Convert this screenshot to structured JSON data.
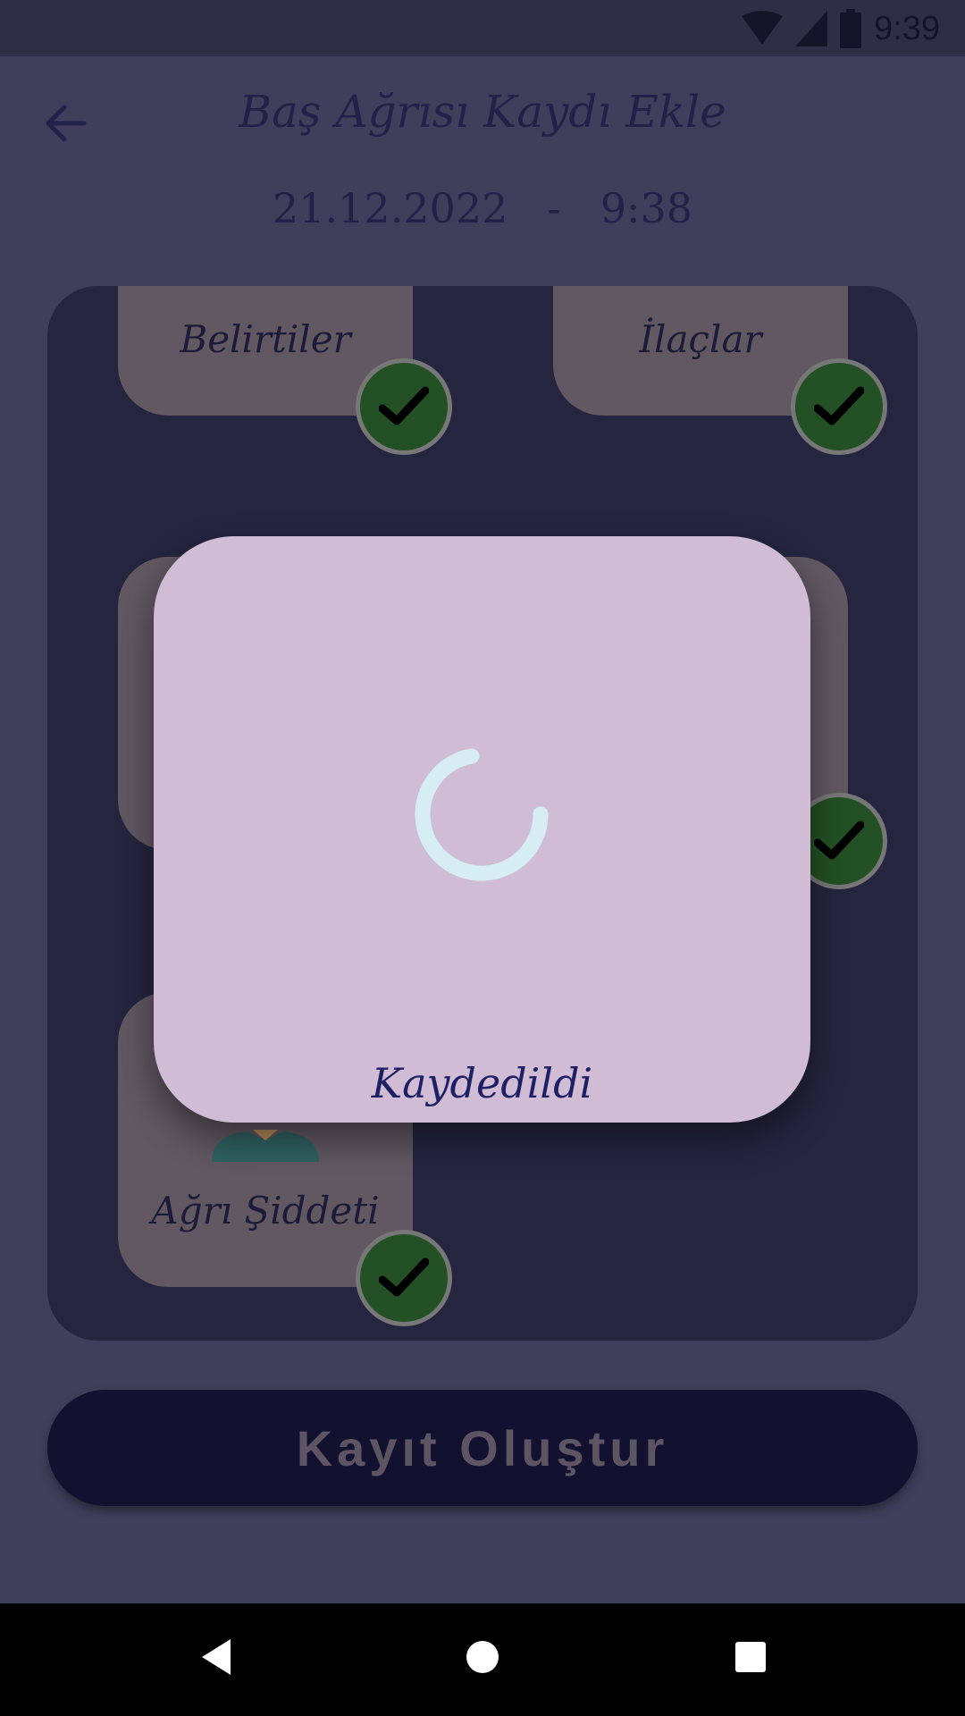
{
  "status_bar": {
    "time": "9:39",
    "icons": [
      "wifi-icon",
      "signal-icon",
      "battery-icon"
    ]
  },
  "header": {
    "title": "Baş Ağrısı Kaydı Ekle",
    "date": "21.12.2022",
    "separator": "-",
    "time": "9:38",
    "back_icon": "arrow-left-icon"
  },
  "cards": [
    {
      "label": "Belirtiler",
      "checked": true
    },
    {
      "label": "İlaçlar",
      "checked": true
    },
    {
      "label": "Ağrı Şiddeti",
      "checked": true
    }
  ],
  "submit_button": {
    "label": "Kayıt Oluştur"
  },
  "dialog": {
    "message": "Kaydedildi",
    "spinner_icon": "loading-spinner-icon"
  },
  "navigation": {
    "icons": [
      "back-triangle-icon",
      "home-circle-icon",
      "recents-square-icon"
    ]
  },
  "colors": {
    "background": "#3f3f5b",
    "panel": "#25253f",
    "card": "#615862",
    "check": "#235024",
    "dialog": "#d0bcd4",
    "button": "#121230"
  }
}
